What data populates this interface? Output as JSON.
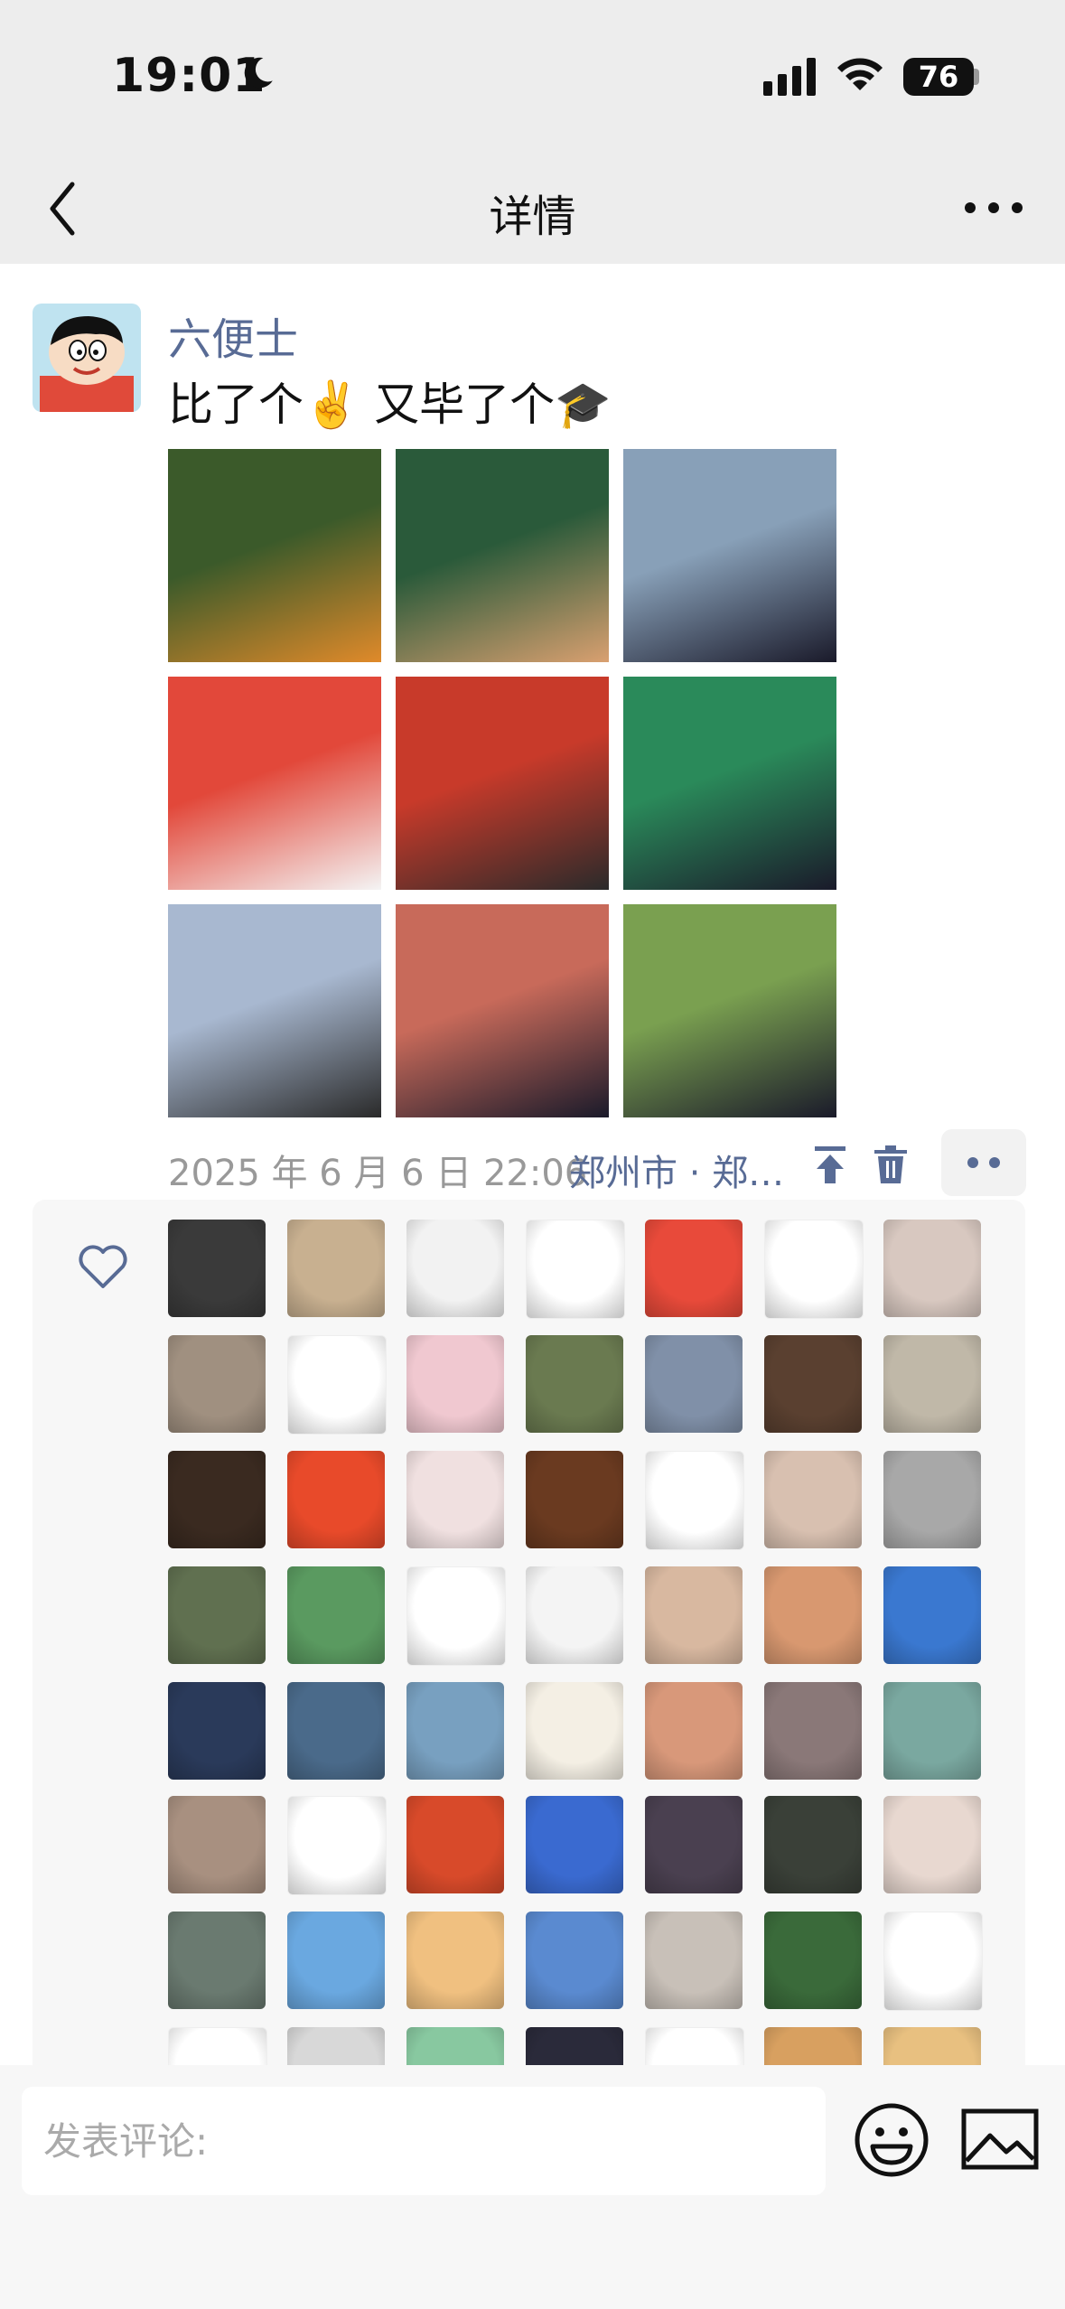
{
  "status_bar": {
    "time": "19:01",
    "battery": "76"
  },
  "nav": {
    "title": "详情"
  },
  "post": {
    "username": "六便士",
    "text": "比了个✌️ 又毕了个🎓",
    "timestamp": "2025 年 6 月 6 日  22:06",
    "location": "郑州市 · 郑…"
  },
  "photos": [
    {
      "c1": "#3b5a2a",
      "c2": "#e08a2a"
    },
    {
      "c1": "#2a5a3a",
      "c2": "#d9a070"
    },
    {
      "c1": "#88a0b8",
      "c2": "#1a1a2a"
    },
    {
      "c1": "#e2483a",
      "c2": "#f4f4f4"
    },
    {
      "c1": "#c83a2a",
      "c2": "#2a2a2a"
    },
    {
      "c1": "#2a8a5a",
      "c2": "#1a1a2a"
    },
    {
      "c1": "#a8b8d0",
      "c2": "#2a2a2a"
    },
    {
      "c1": "#c86a5a",
      "c2": "#1a1a2a"
    },
    {
      "c1": "#7aa050",
      "c2": "#1a1a2a"
    }
  ],
  "likes": [
    "#3a3a3a",
    "#c8b090",
    "#f2f2f2",
    "#ffffff",
    "#e84a3a",
    "#ffffff",
    "#d8c8c0",
    "#a09080",
    "#ffffff",
    "#f0c8d0",
    "#6a7a50",
    "#8090a8",
    "#5a4030",
    "#c0b8a8",
    "#3a2a20",
    "#e84a2a",
    "#f0e0e0",
    "#6a3a20",
    "#ffffff",
    "#d8c0b0",
    "#a8a8a8",
    "#607050",
    "#5a9a60",
    "#ffffff",
    "#f4f4f4",
    "#d8b8a0",
    "#d89870",
    "#3a78d0",
    "#2a3a5a",
    "#4a6a8a",
    "#78a0c0",
    "#f4efe4",
    "#d8987a",
    "#8a7878",
    "#7aa8a0",
    "#a89080",
    "#ffffff",
    "#d84a2a",
    "#3a6ad0",
    "#4a4050",
    "#3a4038",
    "#e8d8d0",
    "#6a7a70",
    "#6aa8e0",
    "#f0c080",
    "#5a8ad0",
    "#c8c0b8",
    "#3a6a3a",
    "#ffffff",
    "#ffffff",
    "#d8d8d8",
    "#88c8a0",
    "#2a2a3a",
    "#ffffff",
    "#d8a060",
    "#e8c080"
  ],
  "comment": {
    "placeholder": "发表评论:"
  }
}
